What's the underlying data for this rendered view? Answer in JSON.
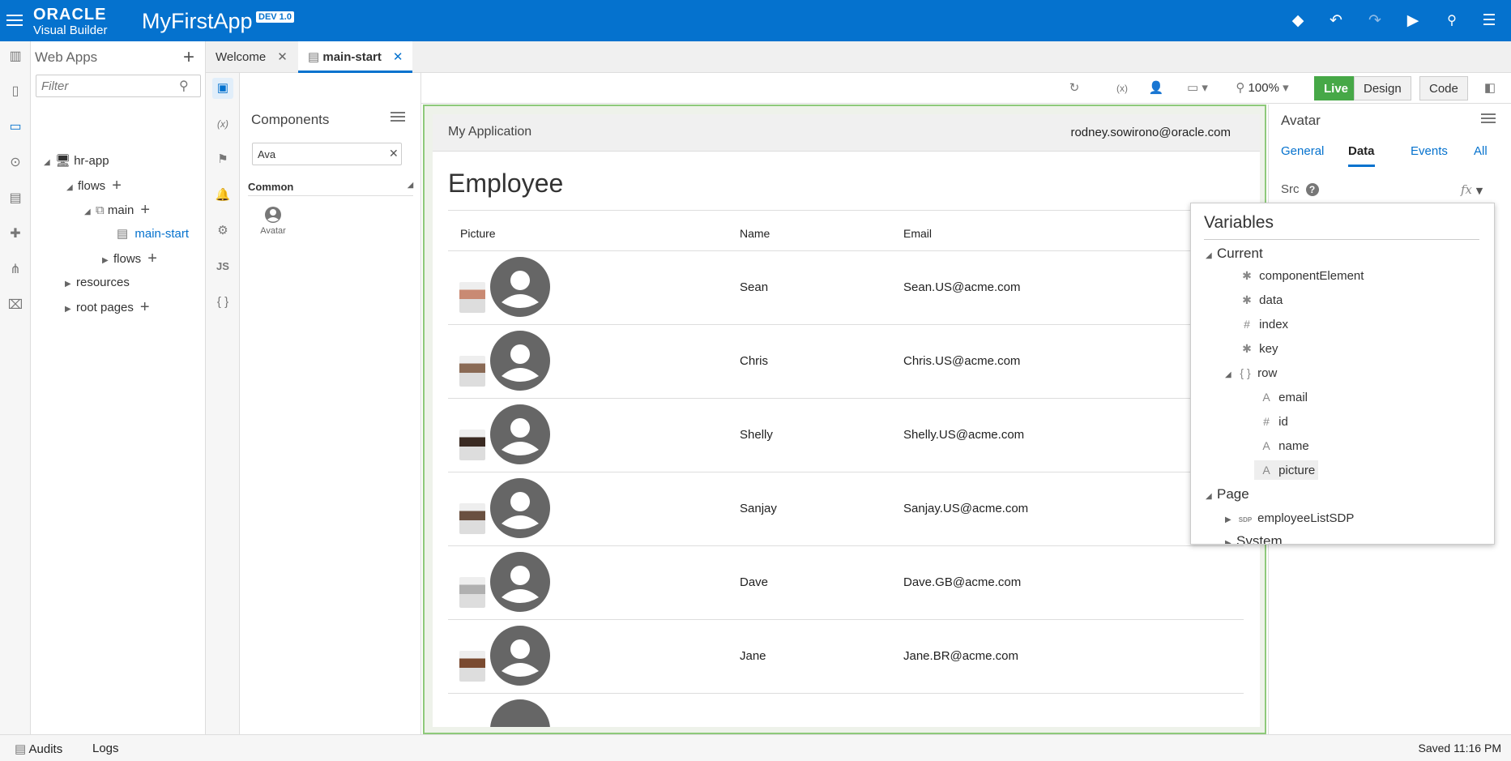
{
  "topbar": {
    "logo_top": "ORACLE",
    "logo_bottom": "Visual Builder",
    "app_title": "MyFirstApp",
    "badge": "DEV 1.0"
  },
  "navpanel": {
    "title": "Web Apps",
    "filter_placeholder": "Filter",
    "tree": [
      {
        "label": "hr-app"
      },
      {
        "label": "flows"
      },
      {
        "label": "main"
      },
      {
        "label": "main-start"
      },
      {
        "label": "flows"
      },
      {
        "label": "resources"
      },
      {
        "label": "root pages"
      }
    ]
  },
  "tabs": [
    {
      "label": "Welcome"
    },
    {
      "label": "main-start"
    }
  ],
  "palette": {
    "title": "Components",
    "search_value": "Ava",
    "section": "Common",
    "item": "Avatar"
  },
  "toolbar": {
    "zoom": "100%",
    "live": "Live",
    "design": "Design",
    "code": "Code"
  },
  "app": {
    "header_title": "My Application",
    "user": "rodney.sowirono@oracle.com",
    "heading": "Employee",
    "columns": [
      "Picture",
      "Name",
      "Email"
    ],
    "rows": [
      {
        "name": "Sean",
        "email": "Sean.US@acme.com"
      },
      {
        "name": "Chris",
        "email": "Chris.US@acme.com"
      },
      {
        "name": "Shelly",
        "email": "Shelly.US@acme.com"
      },
      {
        "name": "Sanjay",
        "email": "Sanjay.US@acme.com"
      },
      {
        "name": "Dave",
        "email": "Dave.GB@acme.com"
      },
      {
        "name": "Jane",
        "email": "Jane.BR@acme.com"
      }
    ]
  },
  "inspector": {
    "title": "Avatar",
    "tabs": [
      "General",
      "Data",
      "Events",
      "All"
    ],
    "src_label": "Src",
    "fx": "fx"
  },
  "variables": {
    "title": "Variables",
    "current": "Current",
    "items": [
      "componentElement",
      "data",
      "index",
      "key",
      "row"
    ],
    "row_items": [
      "email",
      "id",
      "name",
      "picture"
    ],
    "page": "Page",
    "page_items": [
      "employeeListSDP"
    ],
    "sdp_tag": "SDP",
    "system": "System"
  },
  "status": {
    "audits": "Audits",
    "logs": "Logs",
    "saved": "Saved 11:16 PM"
  }
}
